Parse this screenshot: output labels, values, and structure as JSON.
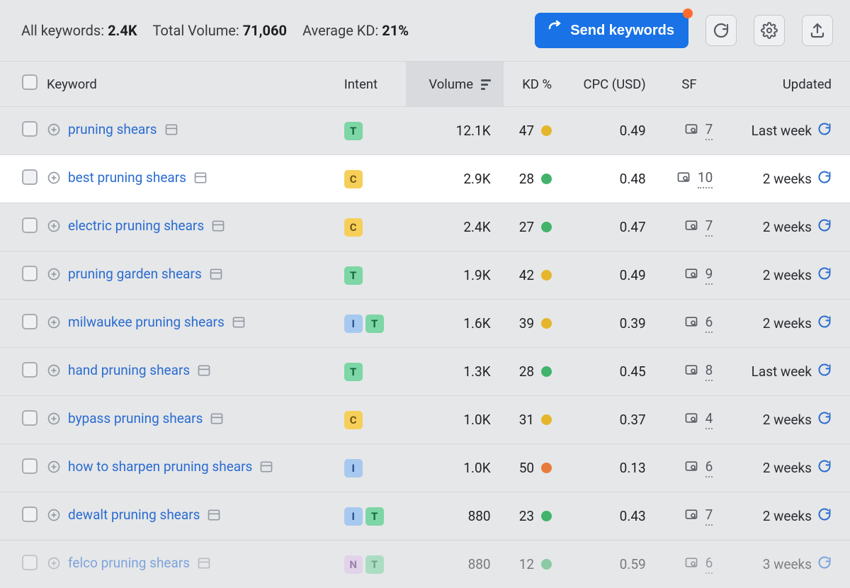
{
  "summary": {
    "all_keywords_label": "All keywords:",
    "all_keywords_value": "2.4K",
    "total_volume_label": "Total Volume:",
    "total_volume_value": "71,060",
    "avg_kd_label": "Average KD:",
    "avg_kd_value": "21%"
  },
  "actions": {
    "send_keywords": "Send keywords"
  },
  "columns": {
    "keyword": "Keyword",
    "intent": "Intent",
    "volume": "Volume",
    "kd": "KD %",
    "cpc": "CPC (USD)",
    "sf": "SF",
    "updated": "Updated"
  },
  "rows": [
    {
      "keyword": "pruning shears",
      "intents": [
        "T"
      ],
      "volume": "12.1K",
      "kd": "47",
      "kd_color": "yellow",
      "cpc": "0.49",
      "sf": "7",
      "updated": "Last week",
      "highlight": false
    },
    {
      "keyword": "best pruning shears",
      "intents": [
        "C"
      ],
      "volume": "2.9K",
      "kd": "28",
      "kd_color": "green",
      "cpc": "0.48",
      "sf": "10",
      "updated": "2 weeks",
      "highlight": true
    },
    {
      "keyword": "electric pruning shears",
      "intents": [
        "C"
      ],
      "volume": "2.4K",
      "kd": "27",
      "kd_color": "green",
      "cpc": "0.47",
      "sf": "7",
      "updated": "2 weeks",
      "highlight": false
    },
    {
      "keyword": "pruning garden shears",
      "intents": [
        "T"
      ],
      "volume": "1.9K",
      "kd": "42",
      "kd_color": "yellow",
      "cpc": "0.49",
      "sf": "9",
      "updated": "2 weeks",
      "highlight": false
    },
    {
      "keyword": "milwaukee pruning shears",
      "intents": [
        "I",
        "T"
      ],
      "volume": "1.6K",
      "kd": "39",
      "kd_color": "yellow",
      "cpc": "0.39",
      "sf": "6",
      "updated": "2 weeks",
      "highlight": false
    },
    {
      "keyword": "hand pruning shears",
      "intents": [
        "T"
      ],
      "volume": "1.3K",
      "kd": "28",
      "kd_color": "green",
      "cpc": "0.45",
      "sf": "8",
      "updated": "Last week",
      "highlight": false
    },
    {
      "keyword": "bypass pruning shears",
      "intents": [
        "C"
      ],
      "volume": "1.0K",
      "kd": "31",
      "kd_color": "yellow",
      "cpc": "0.37",
      "sf": "4",
      "updated": "2 weeks",
      "highlight": false
    },
    {
      "keyword": "how to sharpen pruning shears",
      "intents": [
        "I"
      ],
      "volume": "1.0K",
      "kd": "50",
      "kd_color": "orange",
      "cpc": "0.13",
      "sf": "6",
      "updated": "2 weeks",
      "highlight": false
    },
    {
      "keyword": "dewalt pruning shears",
      "intents": [
        "I",
        "T"
      ],
      "volume": "880",
      "kd": "23",
      "kd_color": "green",
      "cpc": "0.43",
      "sf": "7",
      "updated": "2 weeks",
      "highlight": false
    },
    {
      "keyword": "felco pruning shears",
      "intents": [
        "N",
        "T"
      ],
      "volume": "880",
      "kd": "12",
      "kd_color": "green",
      "cpc": "0.59",
      "sf": "6",
      "updated": "3 weeks",
      "highlight": false,
      "faded": true
    }
  ]
}
